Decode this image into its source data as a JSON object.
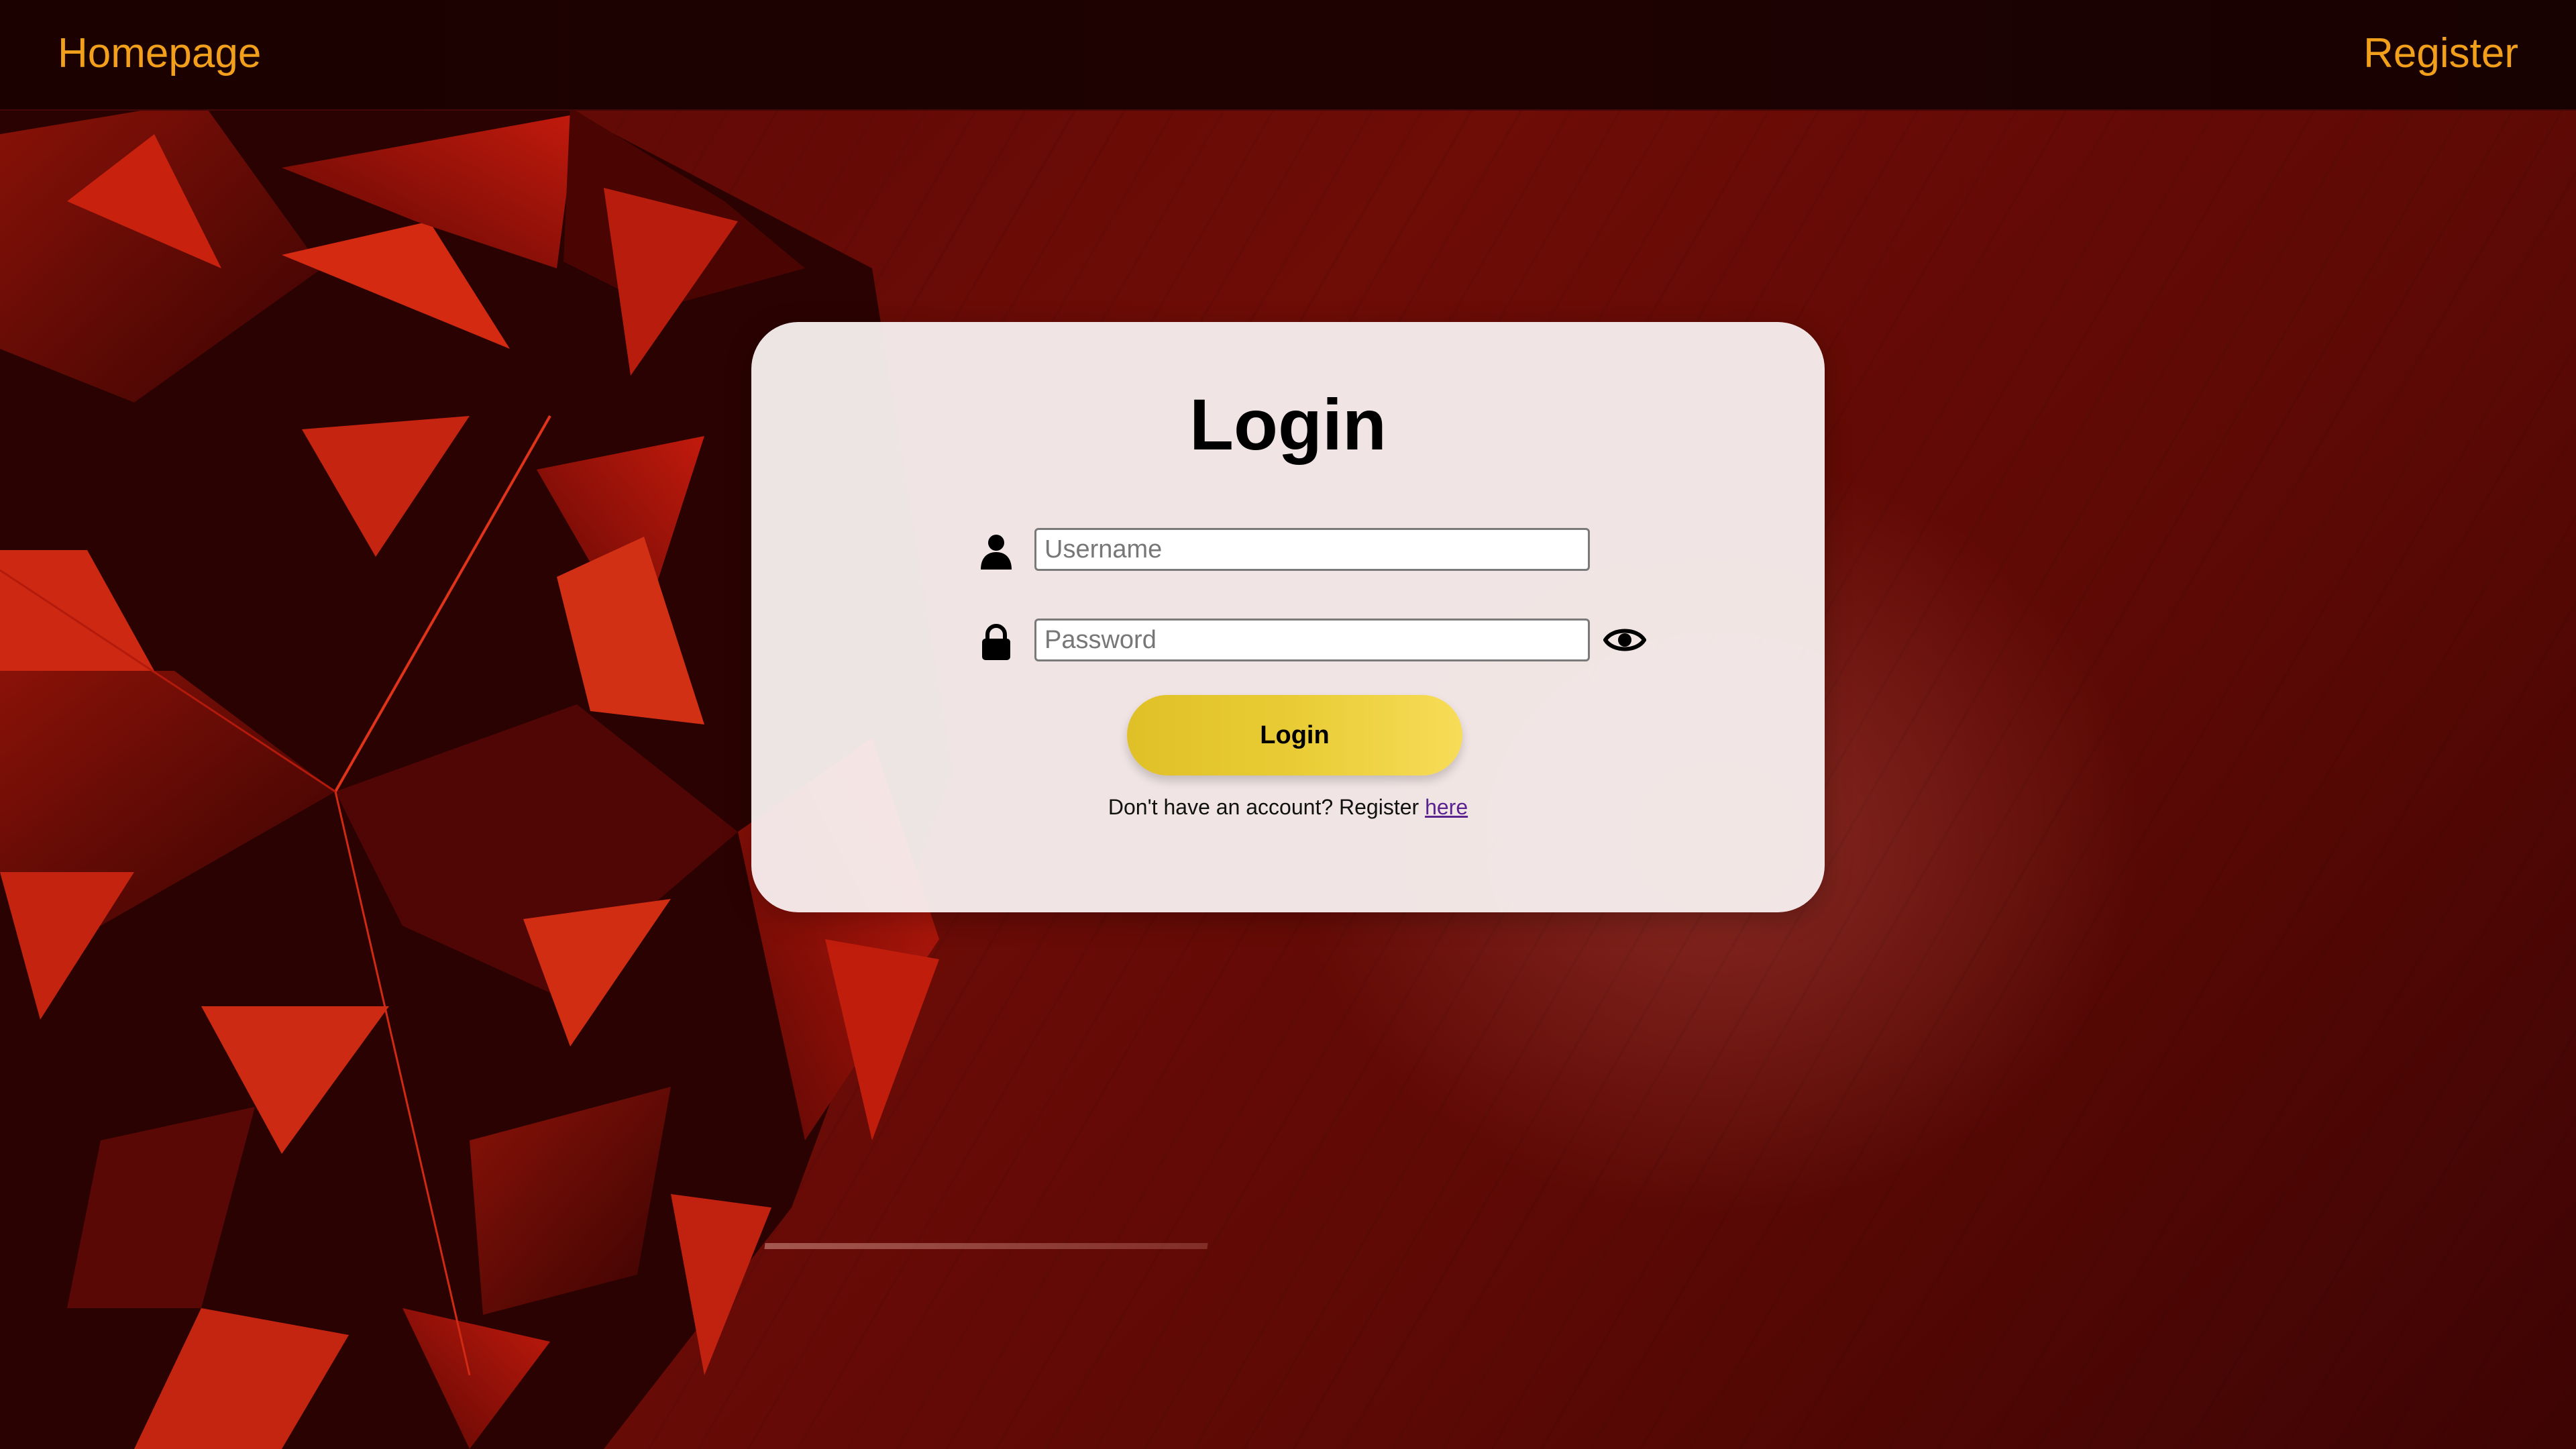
{
  "nav": {
    "home_label": "Homepage",
    "register_label": "Register"
  },
  "login_card": {
    "title": "Login",
    "username": {
      "placeholder": "Username",
      "value": "",
      "icon": "user-icon"
    },
    "password": {
      "placeholder": "Password",
      "value": "",
      "icon": "lock-icon",
      "toggle_icon": "eye-icon"
    },
    "submit_label": "Login",
    "register_prompt": "Don't have an account? Register",
    "register_link": "here"
  },
  "colors": {
    "nav_link": "#f2a01c",
    "button_gradient_start": "#e0c027",
    "button_gradient_end": "#f7dc58",
    "link": "#5b2390",
    "background": "#6e0c06"
  }
}
